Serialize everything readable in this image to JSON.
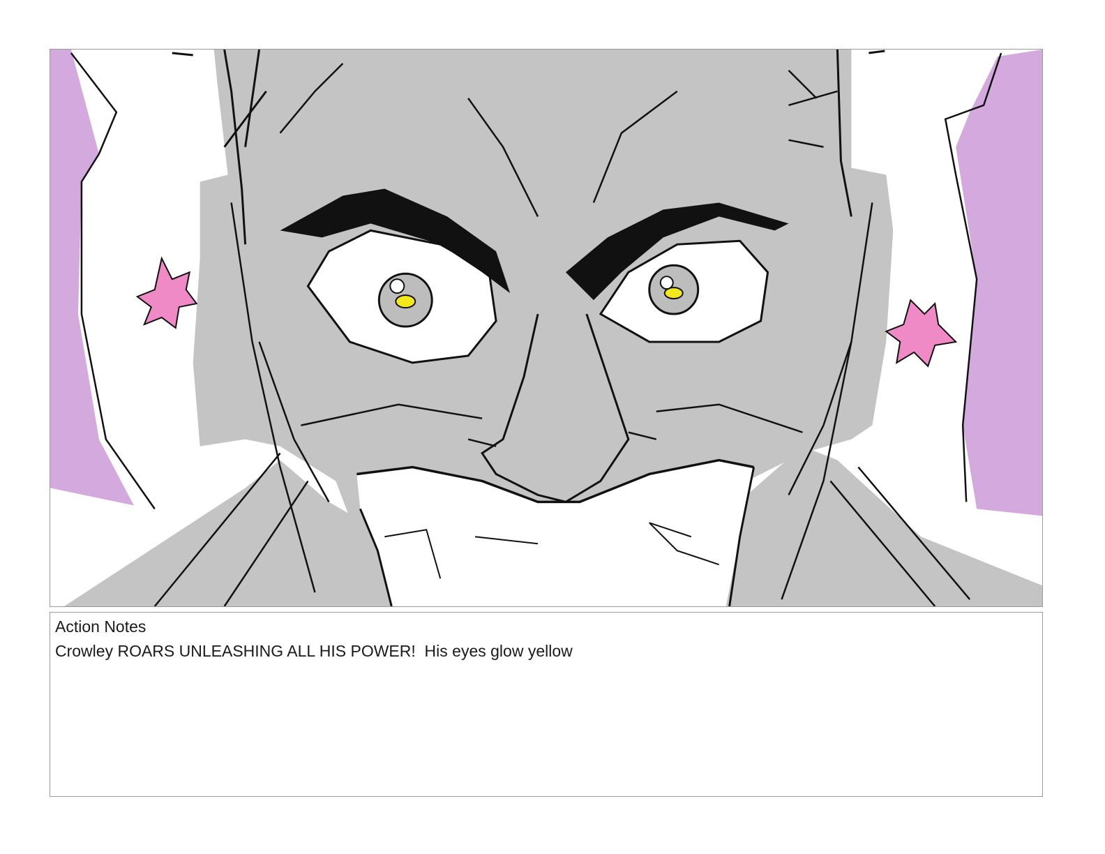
{
  "panel": {
    "image_alt": "Storyboard panel sketch",
    "colors": {
      "background_purple": "#d3a9de",
      "skin_gray": "#c4c4c4",
      "ink": "#111111",
      "earring_pink": "#f08ac6",
      "eye_glow": "#f2e81c"
    }
  },
  "notes": {
    "label": "Action Notes",
    "text": "Crowley ROARS UNLEASHING ALL HIS POWER!  His eyes glow yellow"
  }
}
